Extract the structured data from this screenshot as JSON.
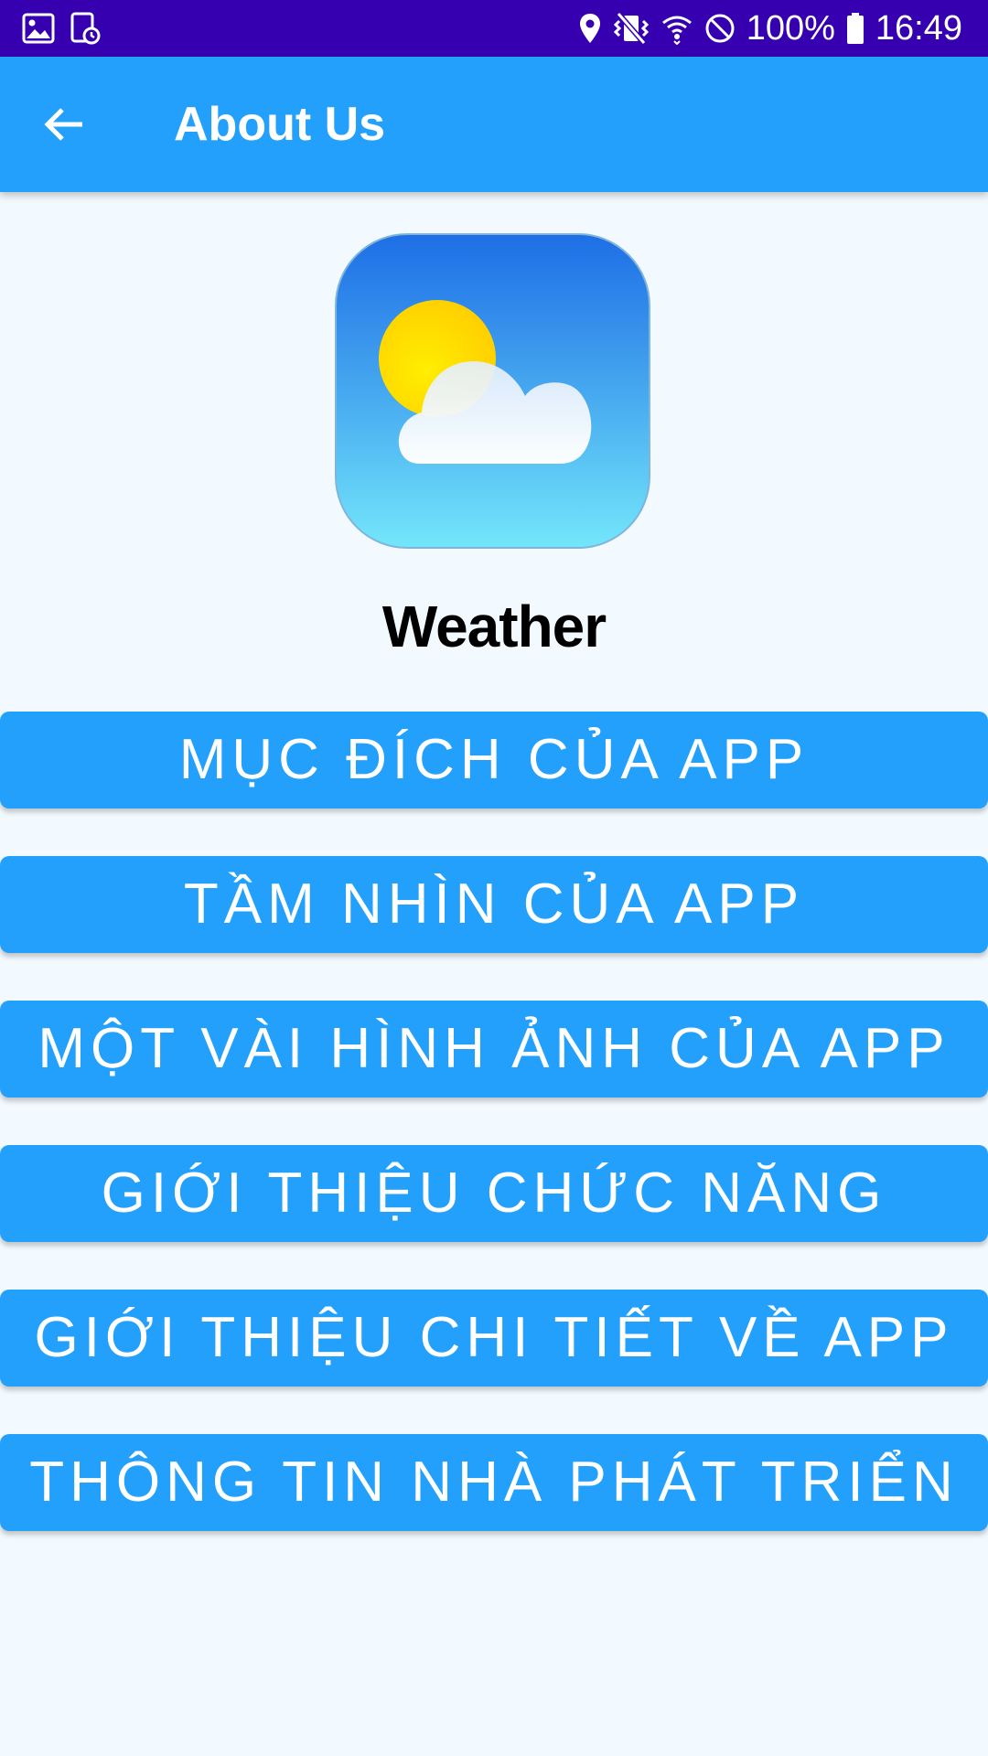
{
  "status_bar": {
    "battery": "100%",
    "time": "16:49",
    "icons": [
      "gallery-icon",
      "screenshot-icon",
      "location-icon",
      "vibrate-icon",
      "wifi-icon",
      "do-not-disturb-icon",
      "battery-icon"
    ]
  },
  "app_bar": {
    "back_icon": "arrow-back-icon",
    "title": "About Us"
  },
  "app_info": {
    "icon": "weather-app-icon",
    "name": "Weather"
  },
  "menu": [
    {
      "label": "MỤC ĐÍCH CỦA APP"
    },
    {
      "label": "TẦM NHÌN CỦA APP"
    },
    {
      "label": "MỘT VÀI HÌNH ẢNH CỦA APP"
    },
    {
      "label": "GIỚI THIỆU CHỨC NĂNG"
    },
    {
      "label": "GIỚI THIỆU CHI TIẾT VỀ APP"
    },
    {
      "label": "THÔNG TIN NHÀ PHÁT TRIỂN"
    }
  ],
  "colors": {
    "status_bar": "#3600b0",
    "primary": "#22a0fb",
    "background": "#f2faff"
  }
}
